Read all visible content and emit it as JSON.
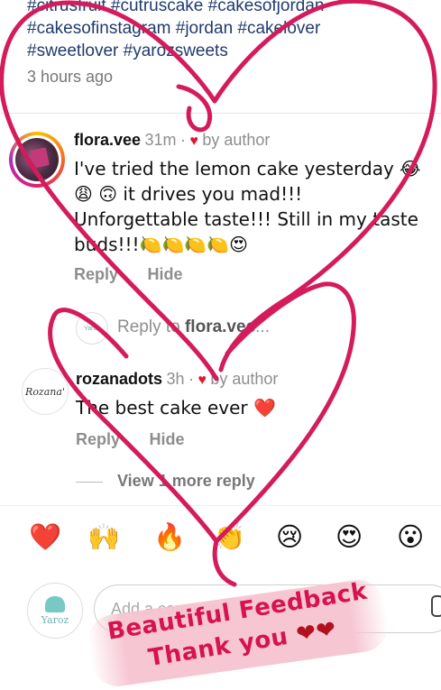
{
  "caption": {
    "hashtag_lines": [
      "#citrusfruit #cutruscake #cakesofjordan",
      "#cakesofinstagram #jordan #cakelover",
      "#sweetlover #yarozsweets"
    ],
    "time": "3 hours ago"
  },
  "comments": [
    {
      "username": "flora.vee",
      "time": "31m",
      "separator": "·",
      "liked_by": "by author",
      "text_lines": [
        "I've tried the lemon cake yesterday 😂",
        "😩  🙃  it drives you mad!!!",
        "Unforgettable taste!!! Still in my taste",
        "buds!!!🍋🍋🍋🍋😍"
      ],
      "reply_label": "Reply",
      "hide_label": "Hide"
    },
    {
      "username": "rozanadots",
      "time": "3h",
      "separator": "·",
      "liked_by": "by author",
      "text": "The best cake ever ❤️",
      "reply_label": "Reply",
      "hide_label": "Hide"
    }
  ],
  "reply_to": {
    "prefix": "Reply to ",
    "user": "flora.vee",
    "suffix": "..."
  },
  "view_more": "View 1 more reply",
  "quick_emojis": [
    "❤️",
    "🙌",
    "🔥",
    "👏",
    "😢",
    "😍",
    "😮"
  ],
  "composer": {
    "placeholder": "Add a comment..."
  },
  "avatars": {
    "yaroz": "Yaroz",
    "rozana": "Rozana'"
  },
  "sticker": {
    "line1": "Beautiful Feedback",
    "line2": "Thank you",
    "hearts": "❤❤"
  },
  "colors": {
    "scribble": "#d41b5b",
    "like_heart": "#e0182d",
    "hashtag": "#1f3b6e"
  }
}
